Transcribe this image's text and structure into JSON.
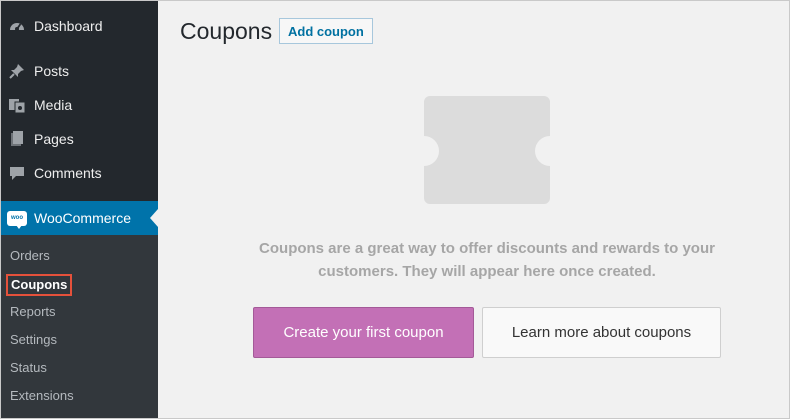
{
  "sidebar": {
    "menu": [
      {
        "label": "Dashboard",
        "icon": "dashboard-icon"
      },
      {
        "label": "Posts",
        "icon": "pin-icon"
      },
      {
        "label": "Media",
        "icon": "media-icon"
      },
      {
        "label": "Pages",
        "icon": "pages-icon"
      },
      {
        "label": "Comments",
        "icon": "comment-icon"
      },
      {
        "label": "WooCommerce",
        "icon": "woo-icon",
        "badge": "woo"
      }
    ],
    "submenu": [
      {
        "label": "Orders"
      },
      {
        "label": "Coupons"
      },
      {
        "label": "Reports"
      },
      {
        "label": "Settings"
      },
      {
        "label": "Status"
      },
      {
        "label": "Extensions"
      }
    ]
  },
  "header": {
    "title": "Coupons",
    "add_label": "Add coupon"
  },
  "empty_state": {
    "icon": "coupon-ticket-icon",
    "message_line1": "Coupons are a great way to offer discounts and rewards to your",
    "message_line2": "customers. They will appear here once created.",
    "primary_label": "Create your first coupon",
    "secondary_label": "Learn more about coupons"
  },
  "colors": {
    "sidebar_bg": "#23282d",
    "submenu_bg": "#32373c",
    "active_bg": "#0073aa",
    "primary_button": "#c370b6",
    "highlight_border": "#e5513b"
  }
}
